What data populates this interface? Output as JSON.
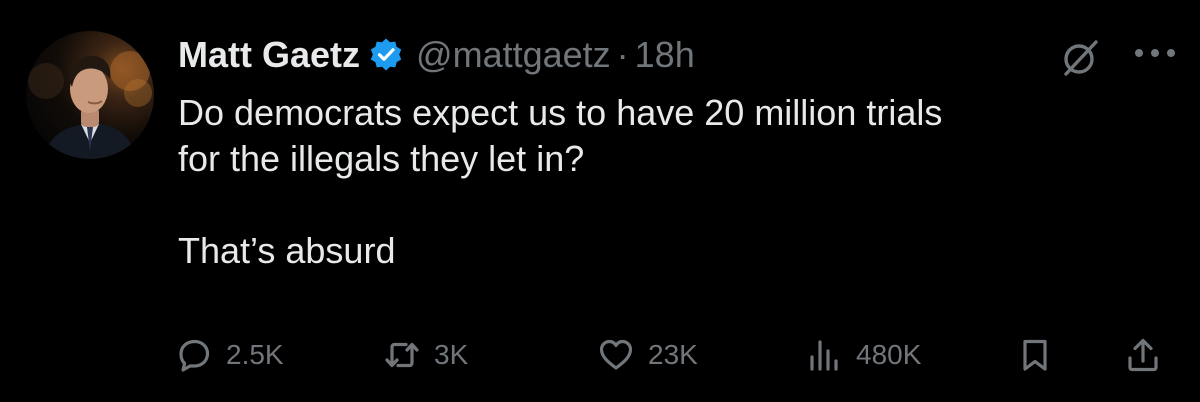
{
  "author": {
    "name": "Matt Gaetz",
    "handle": "@mattgaetz",
    "separator": "·",
    "time": "18h",
    "verified": true
  },
  "tweet": {
    "line1": "Do democrats expect us to have 20 million trials",
    "line2": "for the illegals they let in?",
    "line3": "That’s absurd"
  },
  "actions": {
    "replies": "2.5K",
    "reposts": "3K",
    "likes": "23K",
    "views": "480K"
  },
  "icons": {
    "reply": "reply-icon",
    "repost": "repost-icon",
    "like": "heart-icon",
    "views": "views-icon",
    "bookmark": "bookmark-icon",
    "share": "share-icon",
    "grok": "grok-icon",
    "more": "more-icon",
    "verified": "verified-badge-icon"
  },
  "colors": {
    "background": "#000000",
    "text_primary": "#e7e9ea",
    "text_secondary": "#71767b",
    "verified_blue": "#1d9bf0"
  }
}
